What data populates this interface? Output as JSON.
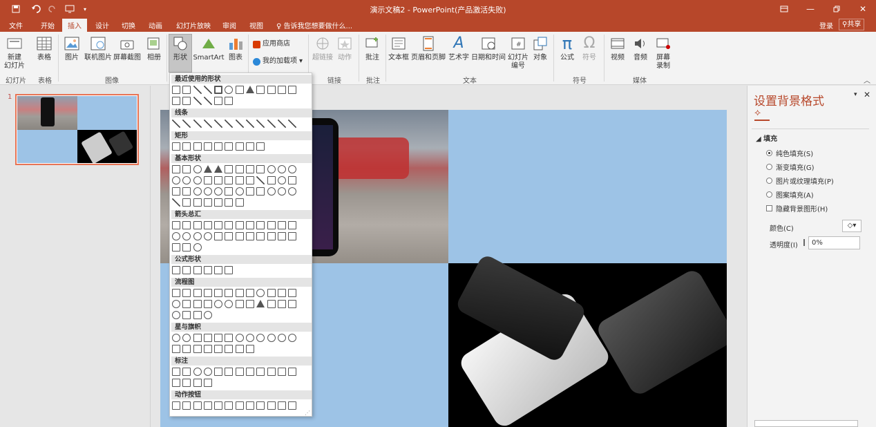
{
  "window": {
    "title": "演示文稿2 - PowerPoint(产品激活失败)"
  },
  "tabs": [
    "文件",
    "开始",
    "插入",
    "设计",
    "切换",
    "动画",
    "幻灯片放映",
    "审阅",
    "视图"
  ],
  "active_tab": "插入",
  "tell_me": "告诉我您想要做什么...",
  "account": {
    "login": "登录",
    "share": "共享"
  },
  "ribbon": {
    "new_slide": "新建\n幻灯片",
    "table": "表格",
    "picture": "图片",
    "online_picture": "联机图片",
    "screenshot": "屏幕截图",
    "album": "相册",
    "shapes": "形状",
    "smartart": "SmartArt",
    "chart": "图表",
    "store": "应用商店",
    "my_addins": "我的加载项",
    "hyperlink": "超链接",
    "action": "动作",
    "comment": "批注",
    "textbox": "文本框",
    "header_footer": "页眉和页脚",
    "wordart": "艺术字",
    "datetime": "日期和时间",
    "slide_number": "幻灯片\n编号",
    "object": "对象",
    "equation": "公式",
    "symbol": "符号",
    "video": "视频",
    "audio": "音频",
    "screen_record": "屏幕\n录制",
    "groups": {
      "slides": "幻灯片",
      "tables": "表格",
      "images": "图像",
      "links": "链接",
      "comments": "批注",
      "text": "文本",
      "symbols": "符号",
      "media": "媒体"
    }
  },
  "thumbnail": {
    "number": "1"
  },
  "shapes_menu": {
    "sections": [
      "最近使用的形状",
      "线条",
      "矩形",
      "基本形状",
      "箭头总汇",
      "公式形状",
      "流程图",
      "星与旗帜",
      "标注",
      "动作按钮"
    ]
  },
  "format_pane": {
    "title": "设置背景格式",
    "section": "填充",
    "options": [
      "纯色填充(S)",
      "渐变填充(G)",
      "图片或纹理填充(P)",
      "图案填充(A)"
    ],
    "selected": "纯色填充(S)",
    "hide_bg": "隐藏背景图形(H)",
    "color_label": "颜色(C)",
    "transparency_label": "透明度(I)",
    "transparency_value": "0%"
  },
  "colors": {
    "accent": "#b7472a",
    "slide_bg": "#9dc3e6"
  }
}
